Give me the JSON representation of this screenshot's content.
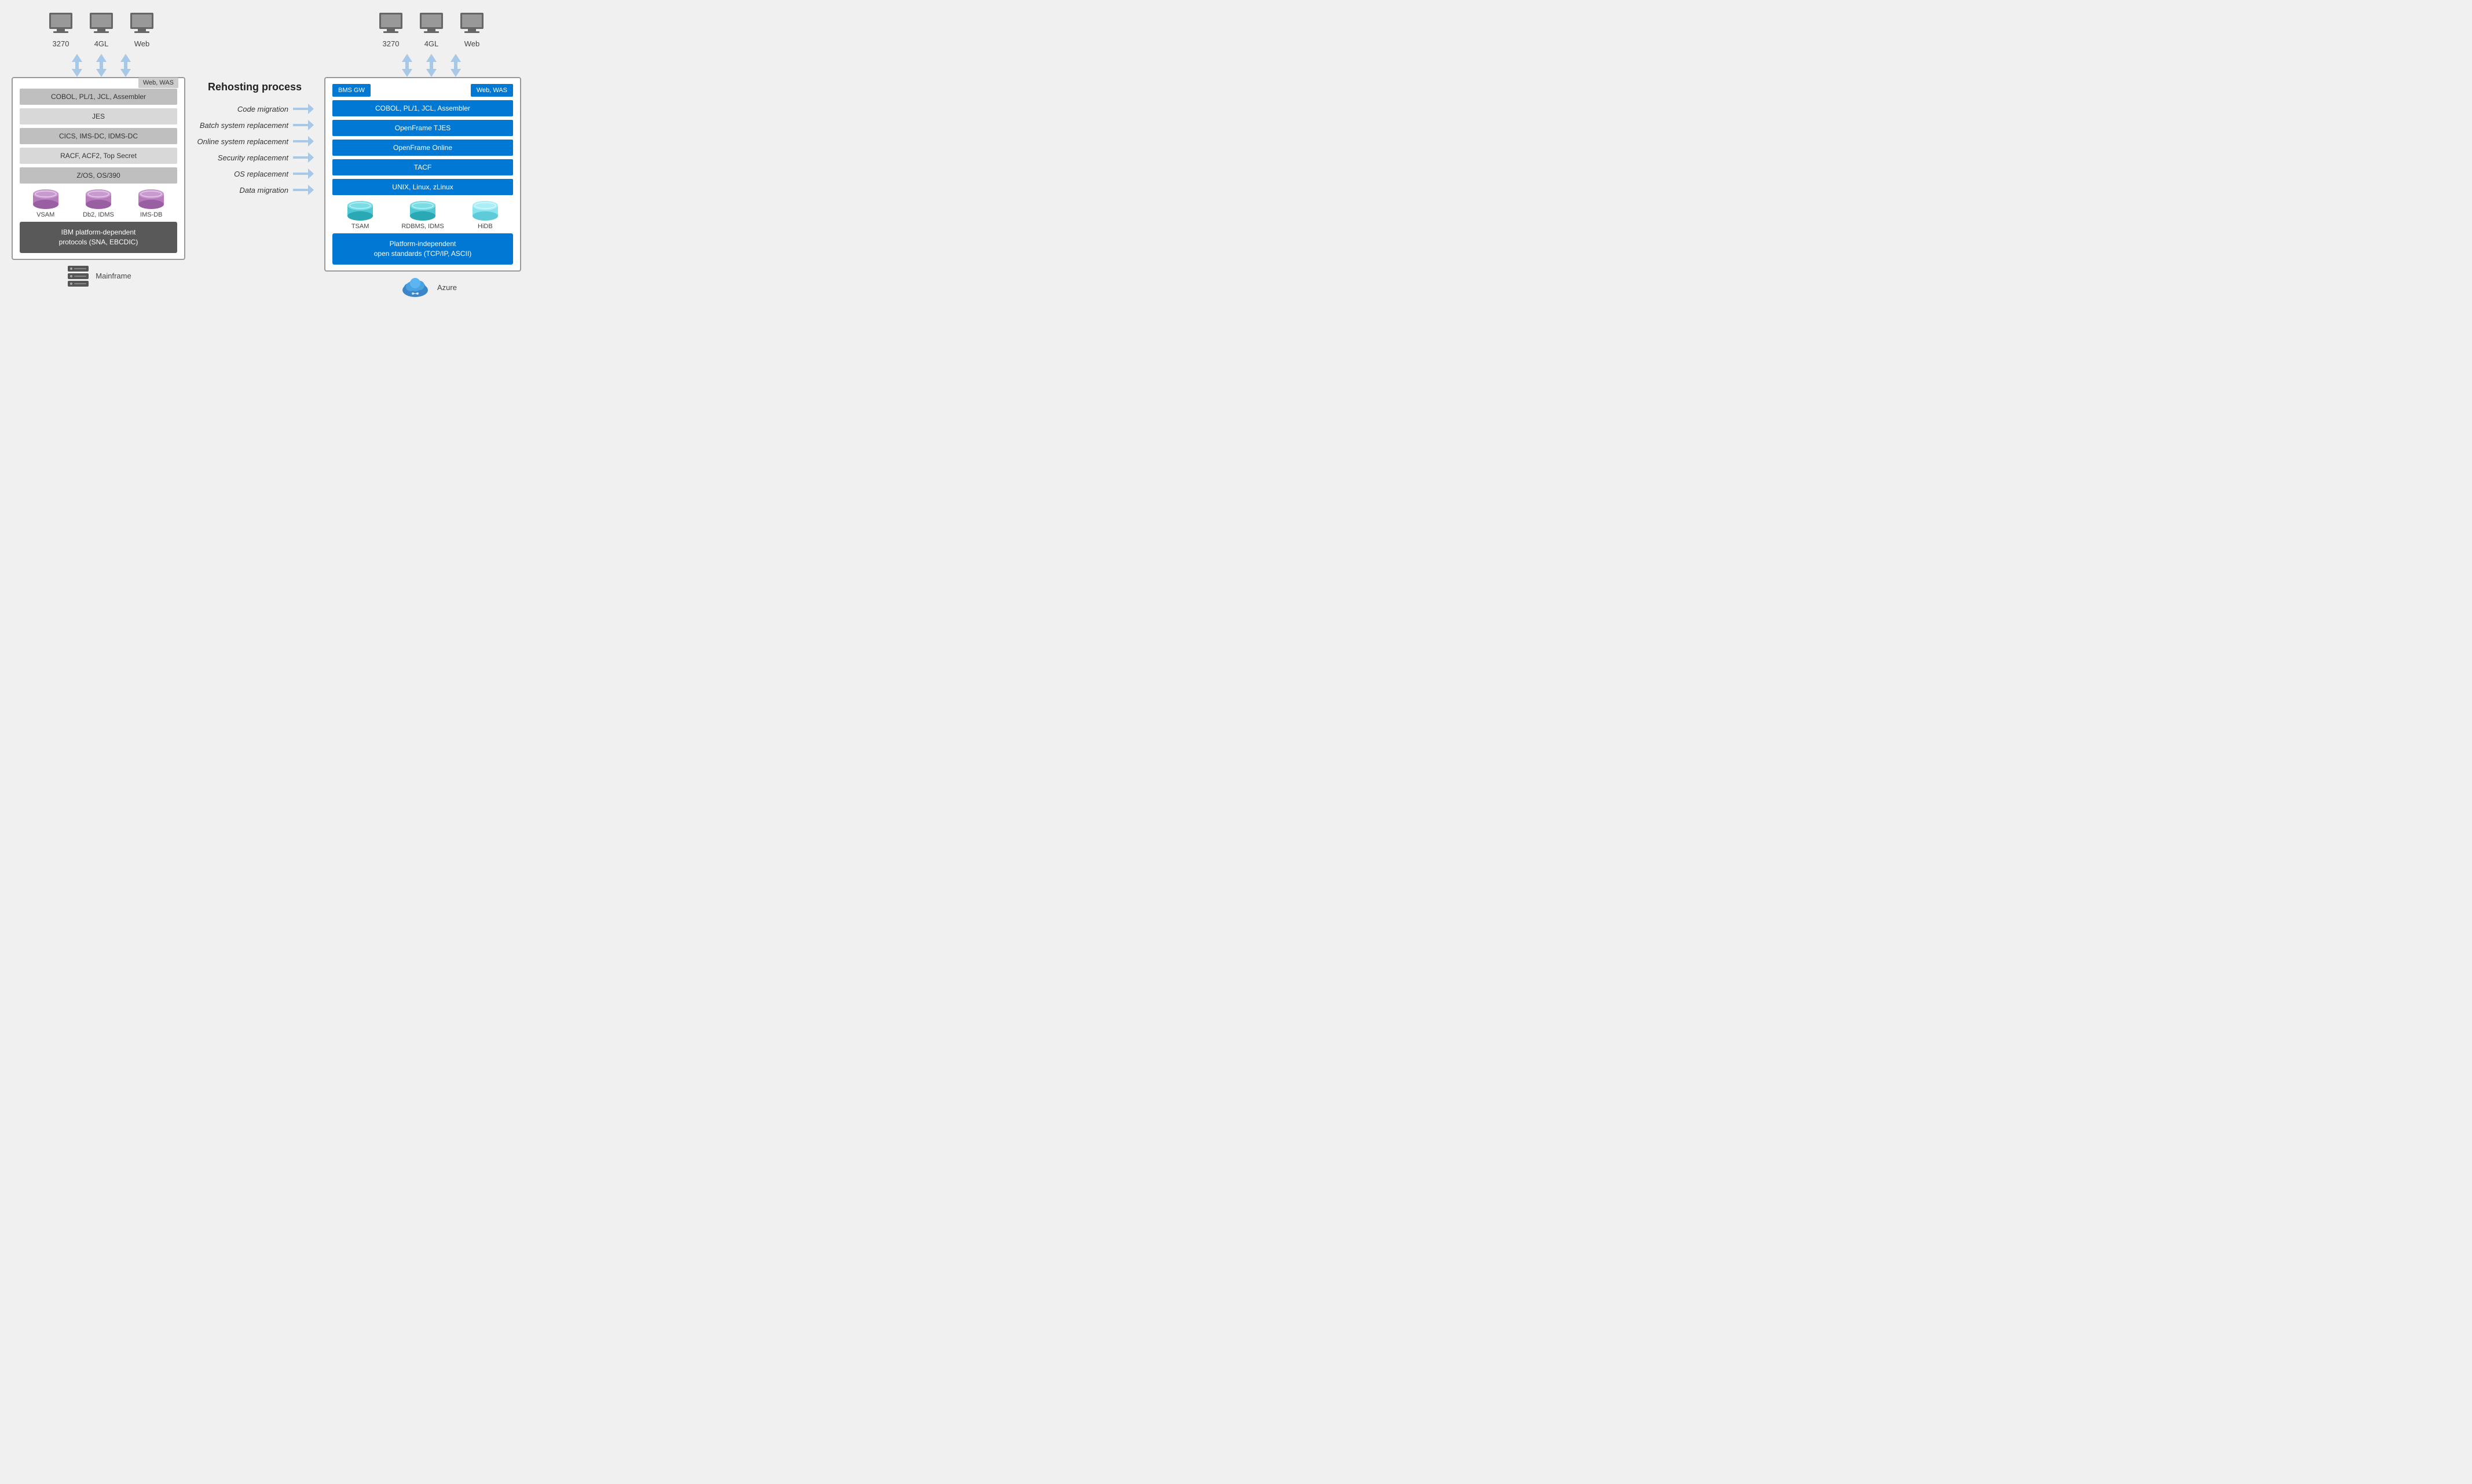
{
  "page": {
    "background": "#f0f0f0"
  },
  "left": {
    "terminals": [
      {
        "label": "3270"
      },
      {
        "label": "4GL"
      },
      {
        "label": "Web"
      }
    ],
    "web_was": "Web, WAS",
    "layers": [
      {
        "text": "COBOL, PL/1, JCL, Assembler",
        "shade": "medium"
      },
      {
        "text": "JES",
        "shade": "light"
      },
      {
        "text": "CICS, IMS-DC, IDMS-DC",
        "shade": "medium"
      },
      {
        "text": "RACF, ACF2, Top Secret",
        "shade": "light"
      },
      {
        "text": "Z/OS, OS/390",
        "shade": "medium"
      }
    ],
    "databases": [
      {
        "label": "VSAM",
        "color": "purple"
      },
      {
        "label": "Db2, IDMS",
        "color": "purple"
      },
      {
        "label": "IMS-DB",
        "color": "purple"
      }
    ],
    "protocols": "IBM platform-dependent\nprotocols (SNA, EBCDIC)",
    "footer_label": "Mainframe"
  },
  "middle": {
    "title": "Rehosting process",
    "steps": [
      {
        "label": "Code migration"
      },
      {
        "label": "Batch system replacement"
      },
      {
        "label": "Online system replacement"
      },
      {
        "label": "Security replacement"
      },
      {
        "label": "OS replacement"
      },
      {
        "label": "Data migration"
      }
    ]
  },
  "right": {
    "terminals": [
      {
        "label": "3270"
      },
      {
        "label": "4GL"
      },
      {
        "label": "Web"
      }
    ],
    "bms_gw": "BMS GW",
    "web_was": "Web, WAS",
    "layers": [
      {
        "text": "COBOL, PL/1, JCL, Assembler"
      },
      {
        "text": "OpenFrame TJES"
      },
      {
        "text": "OpenFrame Online"
      },
      {
        "text": "TACF"
      },
      {
        "text": "UNIX, Linux, zLinux"
      }
    ],
    "databases": [
      {
        "label": "TSAM",
        "color": "cyan"
      },
      {
        "label": "RDBMS, IDMS",
        "color": "cyan"
      },
      {
        "label": "HiDB",
        "color": "cyan"
      }
    ],
    "platform": "Platform-independent\nopen standards (TCP/IP, ASCII)",
    "footer_label": "Azure"
  }
}
